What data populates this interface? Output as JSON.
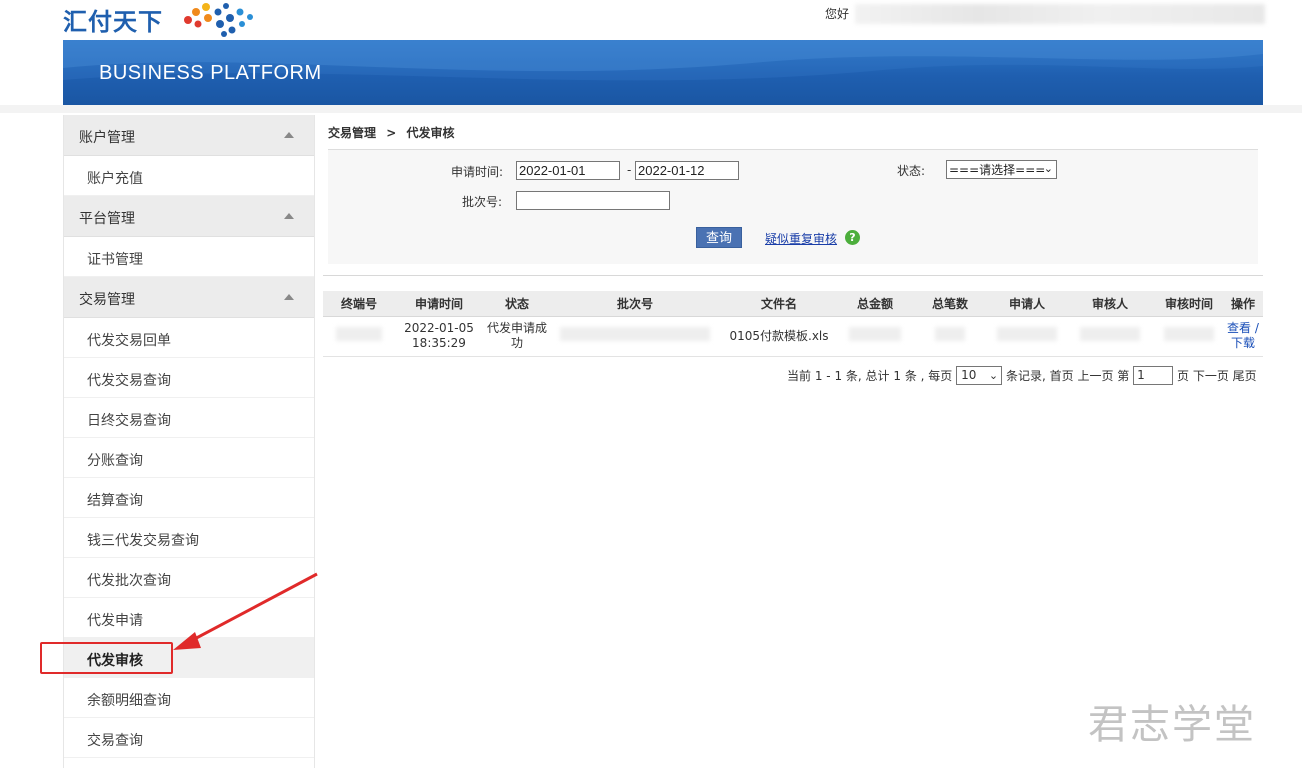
{
  "header": {
    "logo_text": "汇付天下",
    "greeting": "您好",
    "banner_title": "BUSINESS PLATFORM"
  },
  "sidebar": {
    "groups": [
      {
        "label": "账户管理",
        "items": [
          "账户充值"
        ]
      },
      {
        "label": "平台管理",
        "items": [
          "证书管理"
        ]
      },
      {
        "label": "交易管理",
        "items": [
          "代发交易回单",
          "代发交易查询",
          "日终交易查询",
          "分账查询",
          "结算查询",
          "钱三代发交易查询",
          "代发批次查询",
          "代发申请",
          "代发审核",
          "余额明细查询",
          "交易查询"
        ]
      }
    ],
    "active_item": "代发审核"
  },
  "breadcrumb": {
    "parent": "交易管理",
    "separator": ">",
    "current": "代发审核"
  },
  "search": {
    "apply_time_label": "申请时间:",
    "start_date": "2022-01-01",
    "date_separator": "-",
    "end_date": "2022-01-12",
    "status_label": "状态:",
    "status_selected": "===请选择===",
    "batch_label": "批次号:",
    "batch_value": "",
    "query_button": "查询",
    "dup_review_link": "疑似重复审核",
    "help_icon_glyph": "?"
  },
  "table": {
    "headers": [
      "终端号",
      "申请时间",
      "状态",
      "批次号",
      "文件名",
      "总金额",
      "总笔数",
      "申请人",
      "审核人",
      "审核时间",
      "操作"
    ],
    "rows": [
      {
        "apply_time_date": "2022-01-05",
        "apply_time_clock": "18:35:29",
        "status": "代发申请成功",
        "file_name": "0105付款模板.xls",
        "action_view": "查看",
        "action_sep": "/",
        "action_download": "下载"
      }
    ]
  },
  "pager": {
    "prefix": "当前",
    "range": "1 - 1",
    "unit1": "条, 总计",
    "total": "1",
    "unit2": "条 , 每页",
    "page_size": "10",
    "unit3": "条记录,",
    "first": "首页",
    "prev": "上一页",
    "page_prefix": "第",
    "page": "1",
    "page_suffix": "页",
    "next": "下一页",
    "last": "尾页"
  },
  "watermark": "君志学堂",
  "colors": {
    "banner": "#1f5fb0",
    "button": "#4a72b3",
    "link": "#1a3ea8",
    "annotation": "#e02a2a"
  }
}
